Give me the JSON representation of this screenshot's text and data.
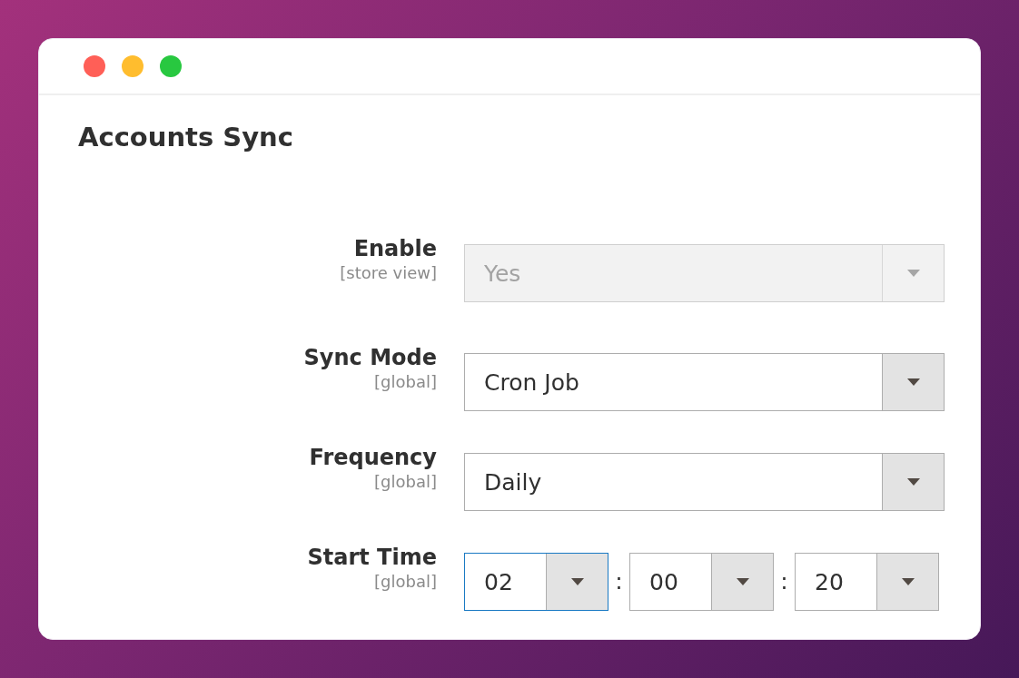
{
  "window": {
    "controls": [
      {
        "color": "#ff5f57"
      },
      {
        "color": "#ffbd2e"
      },
      {
        "color": "#28c840"
      }
    ]
  },
  "title": "Accounts Sync",
  "fields": [
    {
      "kind": "select",
      "label": "Enable",
      "scope": "[store view]",
      "value": "Yes",
      "disabled": true,
      "focused": false
    },
    {
      "kind": "select",
      "label": "Sync Mode",
      "scope": "[global]",
      "value": "Cron Job",
      "disabled": false,
      "focused": false
    },
    {
      "kind": "select",
      "label": "Frequency",
      "scope": "[global]",
      "value": "Daily",
      "disabled": false,
      "focused": false
    },
    {
      "kind": "time",
      "label": "Start Time",
      "scope": "[global]",
      "disabled": false,
      "parts": [
        {
          "value": "02",
          "focused": true,
          "separator": ":"
        },
        {
          "value": "00",
          "focused": false,
          "separator": ":"
        },
        {
          "value": "20",
          "focused": false
        }
      ]
    }
  ]
}
